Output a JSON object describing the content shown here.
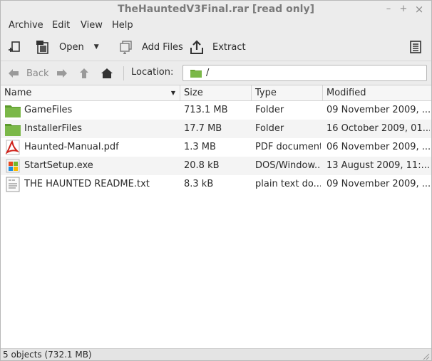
{
  "window": {
    "title": "TheHauntedV3Final.rar [read only]",
    "minimize_glyph": "–",
    "maximize_glyph": "+",
    "close_glyph": "×"
  },
  "menubar": {
    "items": [
      {
        "label": "Archive"
      },
      {
        "label": "Edit"
      },
      {
        "label": "View"
      },
      {
        "label": "Help"
      }
    ]
  },
  "toolbar": {
    "new_icon": "new-archive-icon",
    "open_label": "Open",
    "open_icon": "open-archive-icon",
    "add_files_label": "Add Files",
    "add_files_icon": "add-files-icon",
    "extract_label": "Extract",
    "extract_icon": "extract-icon",
    "properties_icon": "properties-icon"
  },
  "location": {
    "back_label": "Back",
    "label": "Location:",
    "path": "/"
  },
  "columns": {
    "name": "Name",
    "size": "Size",
    "type": "Type",
    "modified": "Modified"
  },
  "files": [
    {
      "icon": "folder-icon",
      "name": "GameFiles",
      "size": "713.1 MB",
      "type": "Folder",
      "modified": "09 November 2009, ..."
    },
    {
      "icon": "folder-icon",
      "name": "InstallerFiles",
      "size": "17.7 MB",
      "type": "Folder",
      "modified": "16 October 2009, 01..."
    },
    {
      "icon": "pdf-icon",
      "name": "Haunted-Manual.pdf",
      "size": "1.3 MB",
      "type": "PDF document",
      "modified": "06 November 2009, ..."
    },
    {
      "icon": "windows-exe-icon",
      "name": "StartSetup.exe",
      "size": "20.8 kB",
      "type": "DOS/Window...",
      "modified": "13 August 2009, 11:..."
    },
    {
      "icon": "text-file-icon",
      "name": "THE HAUNTED README.txt",
      "size": "8.3 kB",
      "type": "plain text do...",
      "modified": "09 November 2009, ..."
    }
  ],
  "status": {
    "text": "5 objects (732.1 MB)"
  },
  "colors": {
    "folder": "#6aa535",
    "pdf_red": "#d0221a",
    "accent_text": "#2b2b2b"
  }
}
